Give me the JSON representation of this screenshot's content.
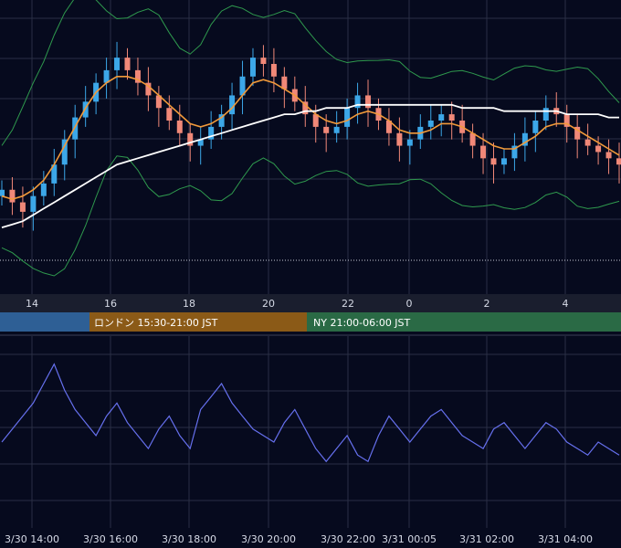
{
  "colors": {
    "background": "#060a1e",
    "grid": "#2a2f45",
    "candle_up": "#3ca7e8",
    "candle_down": "#f08878",
    "bollinger": "#2f9a4e",
    "ma_short": "#f29a3a",
    "ma_long": "#ffffff",
    "oscillator": "#6670ee",
    "session_tokyo": "#2e5f95",
    "session_london": "#8b5a17",
    "session_ny": "#2a6a45"
  },
  "price_axis": {
    "tick_labels": [
      "14",
      "16",
      "18",
      "20",
      "22",
      "0",
      "2",
      "4"
    ]
  },
  "sessions": [
    {
      "id": "tokyo",
      "label": ""
    },
    {
      "id": "london",
      "label": "ロンドン 15:30-21:00 JST"
    },
    {
      "id": "ny",
      "label": "NY 21:00-06:00 JST"
    }
  ],
  "time_axis": {
    "tick_labels": [
      "3/30 14:00",
      "3/30 16:00",
      "3/30 18:00",
      "3/30 20:00",
      "3/30 22:00",
      "3/31 00:05",
      "3/31 02:00",
      "3/31 04:00"
    ]
  },
  "chart_data": [
    {
      "type": "line",
      "title": "",
      "grid": true,
      "candles": {
        "direction_legend": [
          "up",
          "down"
        ]
      },
      "series": [
        {
          "role": "close",
          "values": [
            62,
            58,
            55,
            60,
            64,
            70,
            78,
            85,
            90,
            96,
            100,
            104,
            100,
            96,
            92,
            88,
            84,
            80,
            76,
            78,
            82,
            86,
            92,
            98,
            104,
            102,
            98,
            94,
            90,
            86,
            82,
            80,
            82,
            88,
            92,
            88,
            84,
            80,
            76,
            78,
            82,
            84,
            86,
            84,
            80,
            76,
            72,
            70,
            72,
            76,
            80,
            84,
            88,
            86,
            82,
            78,
            76,
            74,
            72,
            70
          ]
        },
        {
          "role": "ma_short",
          "values": [
            60,
            59,
            60,
            62,
            65,
            70,
            76,
            82,
            88,
            93,
            96,
            98,
            98,
            97,
            95,
            92,
            89,
            86,
            83,
            82,
            83,
            85,
            88,
            92,
            96,
            97,
            96,
            94,
            92,
            89,
            86,
            84,
            83,
            84,
            86,
            87,
            86,
            84,
            81,
            80,
            80,
            81,
            83,
            83,
            82,
            80,
            78,
            76,
            75,
            75,
            77,
            79,
            82,
            83,
            83,
            81,
            79,
            77,
            75,
            73
          ]
        },
        {
          "role": "ma_long",
          "values": [
            50,
            51,
            52,
            54,
            56,
            58,
            60,
            62,
            64,
            66,
            68,
            70,
            71,
            72,
            73,
            74,
            75,
            76,
            77,
            78,
            79,
            80,
            81,
            82,
            83,
            84,
            85,
            86,
            86,
            87,
            87,
            88,
            88,
            88,
            89,
            89,
            89,
            89,
            89,
            89,
            89,
            89,
            89,
            89,
            88,
            88,
            88,
            88,
            87,
            87,
            87,
            87,
            87,
            87,
            86,
            86,
            86,
            86,
            85,
            85
          ]
        }
      ]
    },
    {
      "type": "line",
      "title": "",
      "grid": true,
      "series": [
        {
          "role": "oscillator",
          "values": [
            48,
            52,
            56,
            60,
            66,
            72,
            64,
            58,
            54,
            50,
            56,
            60,
            54,
            50,
            46,
            52,
            56,
            50,
            46,
            58,
            62,
            66,
            60,
            56,
            52,
            50,
            48,
            54,
            58,
            52,
            46,
            42,
            46,
            50,
            44,
            42,
            50,
            56,
            52,
            48,
            52,
            56,
            58,
            54,
            50,
            48,
            46,
            52,
            54,
            50,
            46,
            50,
            54,
            52,
            48,
            46,
            44,
            48,
            46,
            44
          ]
        }
      ]
    }
  ]
}
